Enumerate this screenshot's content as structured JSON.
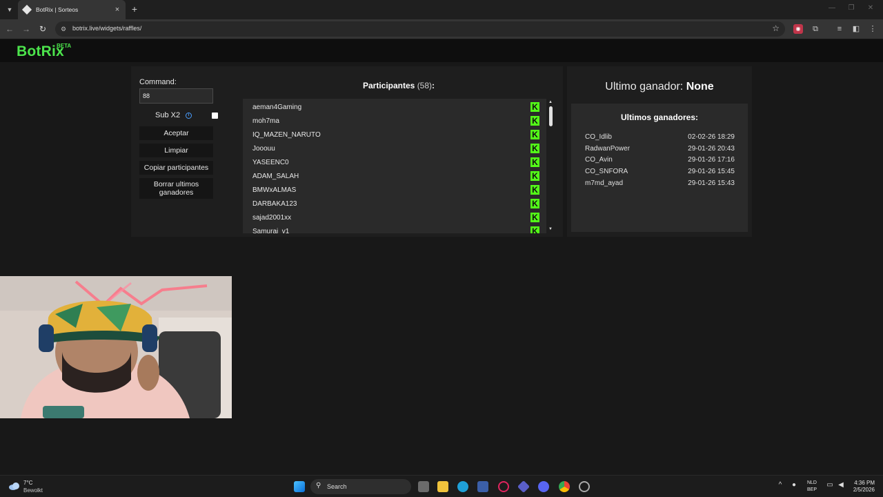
{
  "browser": {
    "tab_title": "BotRix | Sorteos",
    "tab_close": "×",
    "new_tab": "+",
    "url": "botrix.live/widgets/raffles/"
  },
  "header": {
    "logo": "BotRix",
    "badge": "BETA",
    "brand_color": "#4ce44c"
  },
  "controls": {
    "command_label": "Command:",
    "command_value": "88",
    "sub_label": "Sub X2",
    "sub_checked": false,
    "accept": "Aceptar",
    "clear": "Limpiar",
    "copy": "Copiar participantes",
    "clear_winners": "Borrar ultimos ganadores"
  },
  "participants": {
    "title": "Participantes",
    "count": "(58)",
    "suffix": ":",
    "icon_color": "#53fc18",
    "names": [
      "aeman4Gaming",
      "moh7ma",
      "IQ_MAZEN_NARUTO",
      "Jooouu",
      "YASEENC0",
      "ADAM_SALAH",
      "BMWxALMAS",
      "DARBAKA123",
      "sajad2001xx",
      "Samurai_v1"
    ]
  },
  "winner": {
    "label": "Ultimo ganador:",
    "value": "None"
  },
  "last_winners": {
    "title": "Ultimos ganadores:",
    "rows": [
      {
        "name": "CO_Idlib",
        "date": "02-02-26 18:29"
      },
      {
        "name": "RadwanPower",
        "date": "29-01-26 20:43"
      },
      {
        "name": "CO_Avin",
        "date": "29-01-26 17:16"
      },
      {
        "name": "CO_SNFORA",
        "date": "29-01-26 15:45"
      },
      {
        "name": "m7md_ayad",
        "date": "29-01-26 15:43"
      }
    ]
  },
  "taskbar": {
    "temp": "7°C",
    "weather": "Bewolkt",
    "search": "Search",
    "lang_1": "NLD",
    "lang_2": "BEP",
    "time": "4:36 PM",
    "date": "2/5/2026"
  }
}
